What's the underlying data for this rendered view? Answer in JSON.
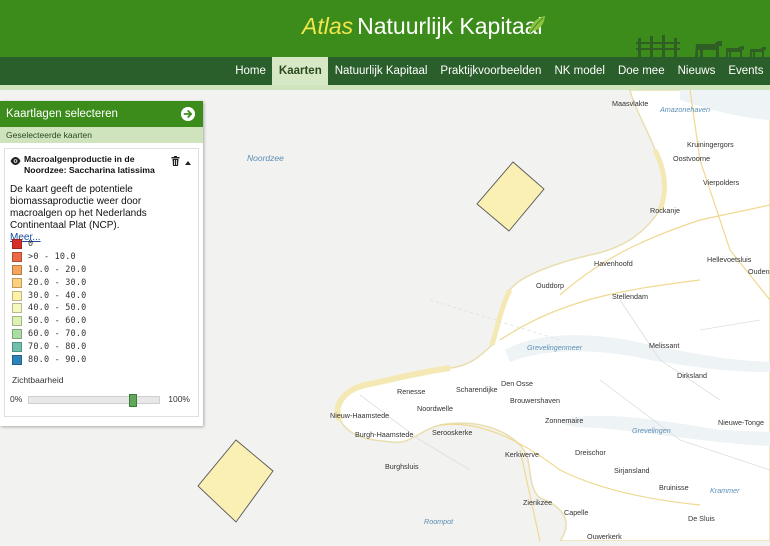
{
  "header": {
    "logo_atlas": "Atlas",
    "logo_rest": "Natuurlijk Kapitaal"
  },
  "nav": {
    "items": [
      "Home",
      "Kaarten",
      "Natuurlijk Kapitaal",
      "Praktijkvoorbeelden",
      "NK model",
      "Doe mee",
      "Nieuws",
      "Events"
    ],
    "active": "Kaarten"
  },
  "panel": {
    "title": "Kaartlagen selecteren",
    "subtitle": "Geselecteerde kaarten",
    "layer": {
      "title": "Macroalgenproductie in de Noordzee: Saccharina latissima",
      "description": "De kaart geeft de potentiele biomassaproductie weer door macroalgen op het Nederlands Continentaal Plat (NCP).",
      "more": "Meer..."
    },
    "legend": [
      {
        "label": "0",
        "color": "#d7302b"
      },
      {
        "label": ">0 - 10.0",
        "color": "#ec6a43"
      },
      {
        "label": "10.0 - 20.0",
        "color": "#f7a55c"
      },
      {
        "label": "20.0 - 30.0",
        "color": "#fcd07f"
      },
      {
        "label": "30.0 - 40.0",
        "color": "#fdf0a9"
      },
      {
        "label": "40.0 - 50.0",
        "color": "#f5f9bf"
      },
      {
        "label": "50.0 - 60.0",
        "color": "#ddf1b2"
      },
      {
        "label": "60.0 - 70.0",
        "color": "#abdda4"
      },
      {
        "label": "70.0 - 80.0",
        "color": "#6ec1ac"
      },
      {
        "label": "80.0 - 90.0",
        "color": "#2b83ba"
      }
    ],
    "opacity_label": "Zichtbaarheid",
    "opacity_min": "0%",
    "opacity_max": "100%",
    "opacity_value": 0.8
  },
  "map": {
    "places": [
      "Maasvlakte",
      "Amazonehaven",
      "Oostvoorne",
      "Kruiningergors",
      "Vierpolders",
      "Rockanje",
      "Hellevoetsluis",
      "Oudenh",
      "Havenhoofd",
      "Ouddorp",
      "Stellendam",
      "Melissant",
      "Dirksland",
      "Renesse",
      "Scharendijke",
      "Den Osse",
      "Brouwershaven",
      "Nieuw-Haamstede",
      "Noordwelle",
      "Burgh-Haamstede",
      "Serooskerke",
      "Zonnemaire",
      "Nieuwe-Tonge",
      "Kerkwerve",
      "Dreischor",
      "Burghsluis",
      "Sirjansland",
      "Bruinisse",
      "Zierikzee",
      "Capelle",
      "Ouwerkerk",
      "De Sluis"
    ],
    "waters": [
      "Noordzee",
      "Grevelingenmeer",
      "Grevelingen",
      "Krammer",
      "Roompot"
    ],
    "colors": {
      "sea": "#f2f2f0",
      "land": "#ffffff",
      "beach": "#f6efc5",
      "layer_fill": "#faf0b4",
      "water_label": "#5c8fb6"
    }
  }
}
